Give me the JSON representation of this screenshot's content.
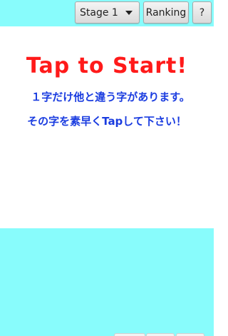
{
  "header": {
    "stage_select": {
      "selected": "Stage 1"
    },
    "ranking_label": "Ranking",
    "help_label": "?"
  },
  "game": {
    "title": "Tap to Start!",
    "instruction_line1": "１字だけ他と違う字があります。",
    "instruction_line2": "その字を素早くTapして下さい！"
  },
  "colors": {
    "accent_cyan": "#88fcfc",
    "title_red": "#ff1a1a",
    "instruction_blue": "#1a3ce0"
  },
  "icons": {
    "dropdown": "chevron-down-icon"
  }
}
